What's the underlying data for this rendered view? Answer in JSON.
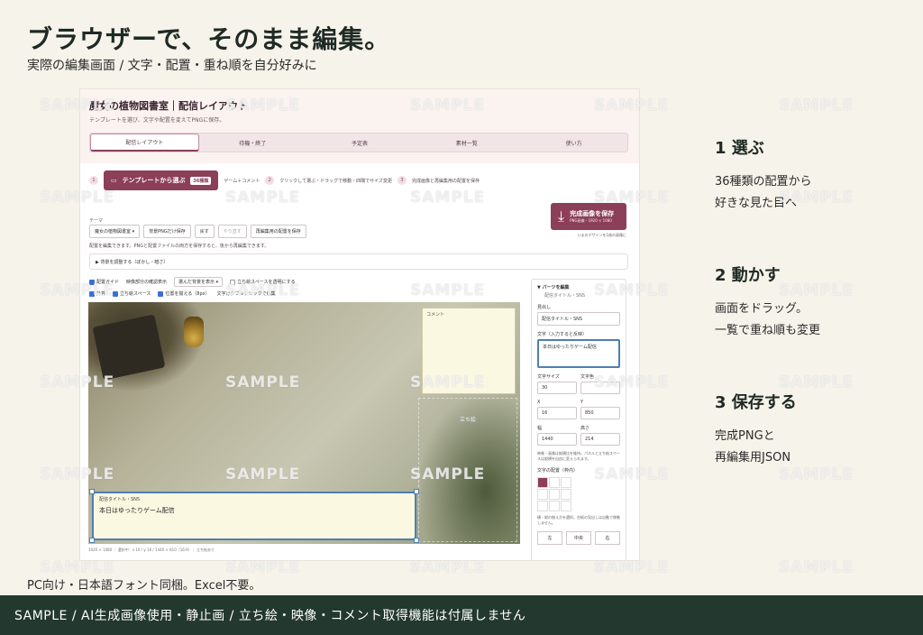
{
  "headline": "ブラウザーで、そのまま編集。",
  "subhead": "実際の編集画面 / 文字・配置・重ね順を自分好みに",
  "app": {
    "title": "魔女の植物図書室｜配信レイアウト",
    "description": "テンプレートを選び、文字や配置を変えてPNGに保存。",
    "tabs": [
      "配信レイアウト",
      "待機・終了",
      "予定表",
      "素材一覧",
      "使い方"
    ],
    "steps": {
      "s1": "1",
      "template_button": "テンプレートから選ぶ",
      "template_count": "36種類",
      "s1_note": "ゲーム＋コメント",
      "s2": "2",
      "s2_text": "クリックして選ぶ・ドラッグで移動・四隅でサイズ変更",
      "s3": "3",
      "s3_text": "完成画像と再編集用の配置を保存"
    },
    "save": {
      "label": "完成画像を保存",
      "sub": "PNG画像・1920 × 1080",
      "note": "いまのデザインを1枚の画像に"
    },
    "theme_label": "テーマ",
    "tools": {
      "theme_select": "魔女の植物図書室",
      "bg_png": "背景PNGだけ保存",
      "undo": "戻す",
      "redo": "やり直す",
      "save_layout": "再編集用の配置を保存"
    },
    "edit_note": "配置を編集できます。PNGと配置ファイルの両方を保存すると、後から再編集できます。",
    "bg_adjust": "▶ 背景を調整する（ぼかし・暗さ）",
    "options": {
      "guide": "配置ガイド",
      "video_check": "映像部分の確認表示",
      "video_select": "選んだ背景を表示",
      "transparent": "立ち絵スペースを透明にする",
      "safe": "外枠",
      "stand_space": "立ち絵スペース",
      "snap": "位置を揃える（8px）",
      "text_note": "文字はダブルクリックで編集"
    },
    "canvas": {
      "comment": "コメント",
      "stand": "立ち絵",
      "title_label": "配信タイトル・SNS",
      "title_text": "本日はゆったりゲーム配信",
      "footer": "1920 × 1080 ｜ 選択中：x 16 / y 16 / 1440 × 810（16:9）｜ 立ち絵あり"
    },
    "panel": {
      "title": "▼ パーツを編集",
      "sub": "配信タイトル・SNS",
      "heading_label": "見出し",
      "heading_value": "配信タイトル・SNS",
      "text_label": "文字（入力すると反映）",
      "text_value": "本日はゆったりゲーム配信",
      "size_label": "文字サイズ",
      "color_label": "文字色",
      "size_value": "30",
      "x_label": "X",
      "y_label": "Y",
      "x_value": "16",
      "y_value": "850",
      "w_label": "幅",
      "h_label": "高さ",
      "w_value": "1440",
      "h_value": "214",
      "note": "映像・画像は縦横比を維持。パネルと立ち絵スペースは縦横を自由に変えられます。",
      "place_label": "文字の配置（枠内）",
      "place_note": "横・縦の揃え方を選択。台紙の見出しは自動で移動しません。",
      "align": [
        "左",
        "中央",
        "右"
      ]
    }
  },
  "steps": [
    {
      "head": "1  選ぶ",
      "body1": "36種類の配置から",
      "body2": "好きな見た目へ"
    },
    {
      "head": "2  動かす",
      "body1": "画面をドラッグ。",
      "body2": "一覧で重ね順も変更"
    },
    {
      "head": "3  保存する",
      "body1": "完成PNGと",
      "body2": "再編集用JSON"
    }
  ],
  "watermark": "SAMPLE",
  "footnote": "PC向け・日本語フォント同梱。Excel不要。",
  "bottom_bar": "SAMPLE / AI生成画像使用・静止画 / 立ち絵・映像・コメント取得機能は付属しません"
}
